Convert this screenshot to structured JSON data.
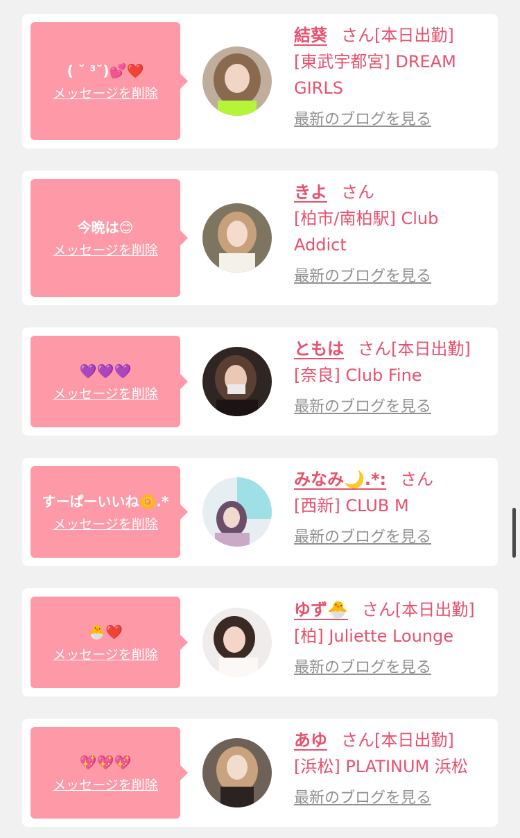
{
  "delete_label": "メッセージを削除",
  "blog_label": "最新のブログを見る",
  "honorific": "さん",
  "accent_color": "#e8506c",
  "bubble_color": "#fe99a7",
  "cards": [
    {
      "message": "( ˘ ³˘)💕❤️",
      "name": "結葵",
      "status": "[本日出勤]",
      "shop": "[東武宇都宮] DREAM GIRLS"
    },
    {
      "message": "今晩は😊",
      "name": "きよ",
      "status": "",
      "shop": "[柏市/南柏駅] Club Addict"
    },
    {
      "message": "💜💜💜",
      "name": "ともは",
      "status": "[本日出勤]",
      "shop": "[奈良] Club Fine"
    },
    {
      "message": "すーぱーいいね🌼.*",
      "name": "みなみ🌙.*:",
      "status": "",
      "shop": "[西新] CLUB M"
    },
    {
      "message": "🐣❤️",
      "name": "ゆず🐣",
      "status": "[本日出勤]",
      "shop": "[柏] Juliette Lounge"
    },
    {
      "message": "💖💖💖",
      "name": "あゆ",
      "status": "[本日出勤]",
      "shop": "[浜松] PLATINUM 浜松"
    }
  ]
}
